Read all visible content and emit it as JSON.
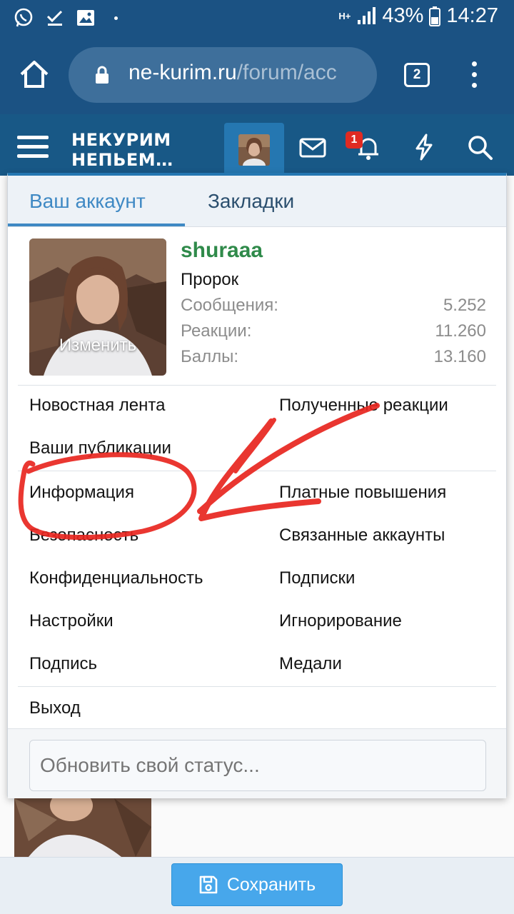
{
  "status_bar": {
    "network": "H+",
    "battery": "43%",
    "time": "14:27"
  },
  "browser": {
    "url_host": "ne-kurim.ru",
    "url_path": "/forum/acc",
    "tab_count": "2"
  },
  "forum_header": {
    "logo_line1": "НЕКУРИМ",
    "logo_line2": "НЕПЬЕМ…",
    "alerts_badge": "1"
  },
  "account_menu": {
    "tabs": [
      {
        "label": "Ваш аккаунт"
      },
      {
        "label": "Закладки"
      }
    ],
    "active_tab": "Ваш аккаунт",
    "profile": {
      "avatar_overlay": "Изменить",
      "username": "shuraaa",
      "user_title": "Пророк",
      "stats": [
        {
          "label": "Сообщения:",
          "value": "5.252"
        },
        {
          "label": "Реакции:",
          "value": "11.260"
        },
        {
          "label": "Баллы:",
          "value": "13.160"
        }
      ]
    },
    "section1": {
      "left": [
        "Новостная лента",
        "Ваши публикации"
      ],
      "right": [
        "Полученные реакции"
      ]
    },
    "section2": {
      "left": [
        "Информация",
        "Безопасность",
        "Конфиденциальность",
        "Настройки",
        "Подпись"
      ],
      "right": [
        "Платные повышения",
        "Связанные аккаунты",
        "Подписки",
        "Игнорирование",
        "Медали"
      ]
    },
    "logout": "Выход",
    "status_placeholder": "Обновить свой статус..."
  },
  "save_button": "Сохранить",
  "colors": {
    "header": "#185886",
    "accent": "#3f89c4",
    "username": "#2f8a4a",
    "annotation": "#e8261f"
  }
}
